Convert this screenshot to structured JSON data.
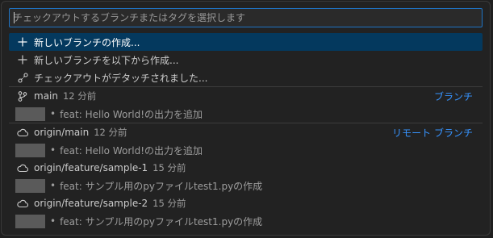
{
  "picker": {
    "placeholder": "チェックアウトするブランチまたはタグを選択します",
    "value": ""
  },
  "actions": [
    {
      "label": "新しいブランチの作成...",
      "icon": "plus-icon"
    },
    {
      "label": "新しいブランチを以下から作成...",
      "icon": "plus-icon"
    },
    {
      "label": "チェックアウトがデタッチされました...",
      "icon": "git-detach-icon"
    }
  ],
  "groups": [
    {
      "kind_label": "ブランチ",
      "items": [
        {
          "name": "main",
          "time": "12 分前",
          "icon": "git-branch-icon",
          "commit": "feat: Hello World!の出力を追加",
          "bullet": "•"
        }
      ]
    },
    {
      "kind_label": "リモート ブランチ",
      "items": [
        {
          "name": "origin/main",
          "time": "12 分前",
          "icon": "cloud-icon",
          "commit": "feat: Hello World!の出力を追加",
          "bullet": "•"
        },
        {
          "name": "origin/feature/sample-1",
          "time": "15 分前",
          "icon": "cloud-icon",
          "commit": "feat: サンプル用のpyファイルtest1.pyの作成",
          "bullet": "•"
        },
        {
          "name": "origin/feature/sample-2",
          "time": "15 分前",
          "icon": "cloud-icon",
          "commit": "feat: サンプル用のpyファイルtest1.pyの作成",
          "bullet": "•"
        }
      ]
    }
  ],
  "colors": {
    "accent": "#3794ff",
    "selection": "#04395e",
    "focus_border": "#1f73c3"
  }
}
